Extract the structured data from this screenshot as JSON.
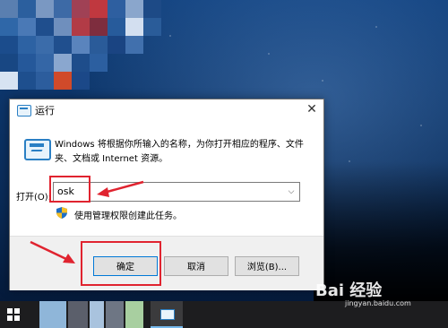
{
  "dialog": {
    "title": "运行",
    "close_glyph": "✕",
    "description": "Windows 将根据你所输入的名称，为你打开相应的程序、文件夹、文档或 Internet 资源。",
    "open_label": "打开(O):",
    "open_value": "osk",
    "admin_note": "使用管理权限创建此任务。",
    "buttons": {
      "ok": "确定",
      "cancel": "取消",
      "browse": "浏览(B)..."
    }
  },
  "watermark": {
    "brand": "Bai  经验",
    "url": "jingyan.baidu.com"
  },
  "colors": {
    "annotation_red": "#e0232f",
    "accent_blue": "#0078d7",
    "taskbar": "#1d1d1f"
  },
  "icons": [
    "run-dialog-icon",
    "close-icon",
    "run-program-icon",
    "chevron-down-icon",
    "uac-shield-icon",
    "windows-start-icon"
  ]
}
